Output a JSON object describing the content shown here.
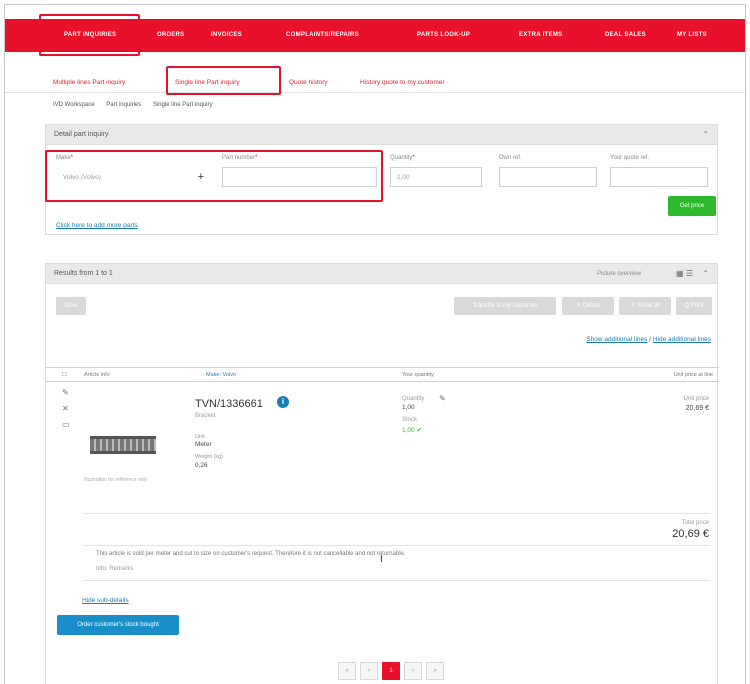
{
  "nav": {
    "items": [
      "PART INQUIRIES",
      "ORDERS",
      "INVOICES",
      "COMPLAINTS/REPAIRS",
      "PARTS LOOK-UP",
      "EXTRA ITEMS",
      "DEAL SALES",
      "MY LISTS"
    ]
  },
  "subnav": {
    "links": [
      "Multiple lines Part inquiry",
      "Single line Part inquiry",
      "Quote history",
      "History quote to my customer"
    ]
  },
  "breadcrumb": [
    "IVD Workspace",
    "Part inquiries",
    "Single line Part inquiry"
  ],
  "inquiry_panel": {
    "title": "Detail part inquiry",
    "make_label": "Make",
    "make_value": "Volvo (Volvo)",
    "part_number_label": "Part number",
    "quantity_label": "Quantity",
    "quantity_value": "1,00",
    "own_ref_label": "Own ref.",
    "your_quote_ref_label": "Your quote ref.",
    "get_price_label": "Get price",
    "add_more_link": "Click here to add more parts",
    "required_mark": "*"
  },
  "results_panel": {
    "title": "Results from 1 to 1",
    "picture_overview_label": "Picture overview",
    "view_icons": "▦ ☰",
    "buttons": {
      "save": "Save",
      "transfer": "Transfer to my customer",
      "delete": "✕ Delete",
      "show_all": "⇩ Show all",
      "print": "⎙ Print"
    },
    "show_hide_links": [
      "Show additional lines",
      "Hide additional lines"
    ],
    "link_separator": "/",
    "columns": [
      "Article info",
      "Make: Volvo",
      "Your quantity",
      "Unit price at line"
    ],
    "row": {
      "part_number": "TVN/1336661",
      "description": "Bracket",
      "unit_label": "Unit",
      "unit_value": "Meter",
      "weight_label": "Weight (kg)",
      "weight_value": "0,26",
      "qty_label": "Quantity",
      "qty_value": "1,00",
      "stock_label": "Stock",
      "stock_value": "1,00",
      "unit_price_label": "Unit price",
      "unit_price_value": "20,69 €",
      "total_label": "Total price",
      "total_value": "20,69 €",
      "image_caption": "Illustration for reference only",
      "note": "This article is sold per meter and cut to size on customer's request. Therefore it is not cancellable and not returnable.",
      "note_sub": "Info: Remarks",
      "hide_link": "Hide sub-details"
    },
    "transfer_button": "Order customer's stock bought"
  },
  "pager": [
    "«",
    "‹",
    "1",
    "›",
    "»"
  ],
  "colors": {
    "brand": "#e8102a",
    "accent_green": "#2eb82e",
    "accent_blue": "#1a8ec9"
  }
}
